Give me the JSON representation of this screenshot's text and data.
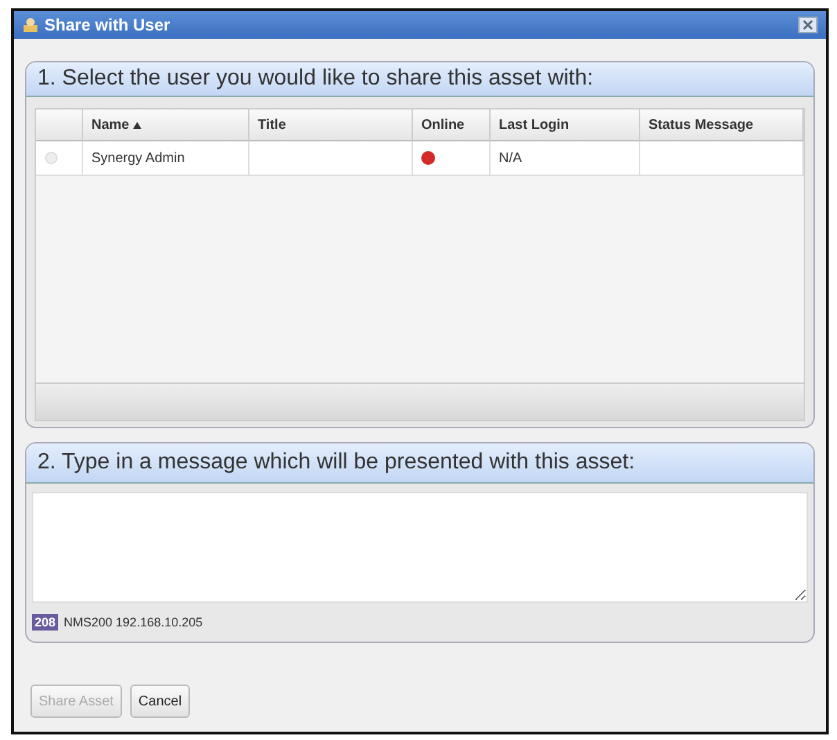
{
  "window": {
    "title": "Share with User"
  },
  "user_section": {
    "heading": "1. Select the user you would like to share this asset with:",
    "columns": [
      {
        "label": "Name",
        "sorted": true
      },
      {
        "label": "Title",
        "sorted": false
      },
      {
        "label": "Online",
        "sorted": false
      },
      {
        "label": "Last Login",
        "sorted": false
      },
      {
        "label": "Status Message",
        "sorted": false
      }
    ],
    "rows": [
      {
        "name": "Synergy Admin",
        "title": "",
        "color": "#d42a2a",
        "last_login": "N/A",
        "status_message": "",
        "selected": false
      }
    ]
  },
  "message_section": {
    "heading": "2. Type in a message which will be presented with this asset:",
    "server_badge": "208",
    "server": "NMS200 192.168.10.205"
  },
  "buttons": [
    {
      "label": "Share Asset",
      "disabled": true
    },
    {
      "label": "Cancel",
      "disabled": false
    }
  ]
}
